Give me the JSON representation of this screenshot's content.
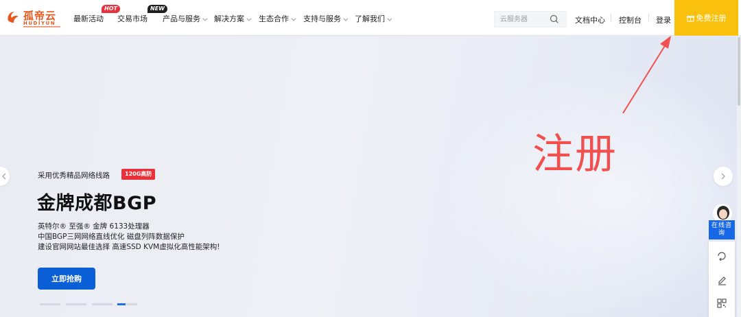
{
  "brand": {
    "name": "孤帝云",
    "sub": "HUDIYUN",
    "color": "#e8571e"
  },
  "nav": {
    "items": [
      {
        "label": "最新活动",
        "badge": "HOT"
      },
      {
        "label": "交易市场",
        "badge": "NEW"
      },
      {
        "label": "产品与服务"
      },
      {
        "label": "解决方案"
      },
      {
        "label": "生态合作"
      },
      {
        "label": "支持与服务"
      },
      {
        "label": "了解我们"
      }
    ]
  },
  "search": {
    "placeholder": "云服务器",
    "icon": "search-icon"
  },
  "links": {
    "docs": "文档中心",
    "console": "控制台",
    "login": "登录",
    "register": "免费注册"
  },
  "hero": {
    "subtitle": "采用优秀精品网络线路",
    "tag": "120G高防",
    "title": "金牌成都BGP",
    "lines": [
      "英特尔® 至强® 金牌 6133处理器",
      "中国BGP三网网络直线优化 磁盘列阵数据保护",
      "建设官网网站最佳选择 高速SSD KVM虚拟化高性能架构!"
    ],
    "cta": "立即抢购",
    "slides": 4,
    "active_slide": 4
  },
  "annotation": {
    "text": "注册",
    "color": "#f05050"
  },
  "side": {
    "consult": "在线咨询",
    "icons": [
      "feedback-icon",
      "edit-icon",
      "qrcode-icon"
    ]
  },
  "colors": {
    "accent": "#f9c10d",
    "primary": "#0b5fd6",
    "hot": "#e8313a"
  }
}
